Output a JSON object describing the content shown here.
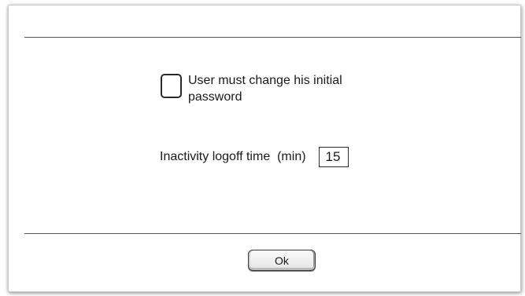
{
  "dialog": {
    "password_checkbox": {
      "label": "User must change his initial password",
      "checked": false
    },
    "inactivity": {
      "label": "Inactivity logoff time  (min)",
      "value": "15"
    },
    "ok_label": "Ok"
  }
}
